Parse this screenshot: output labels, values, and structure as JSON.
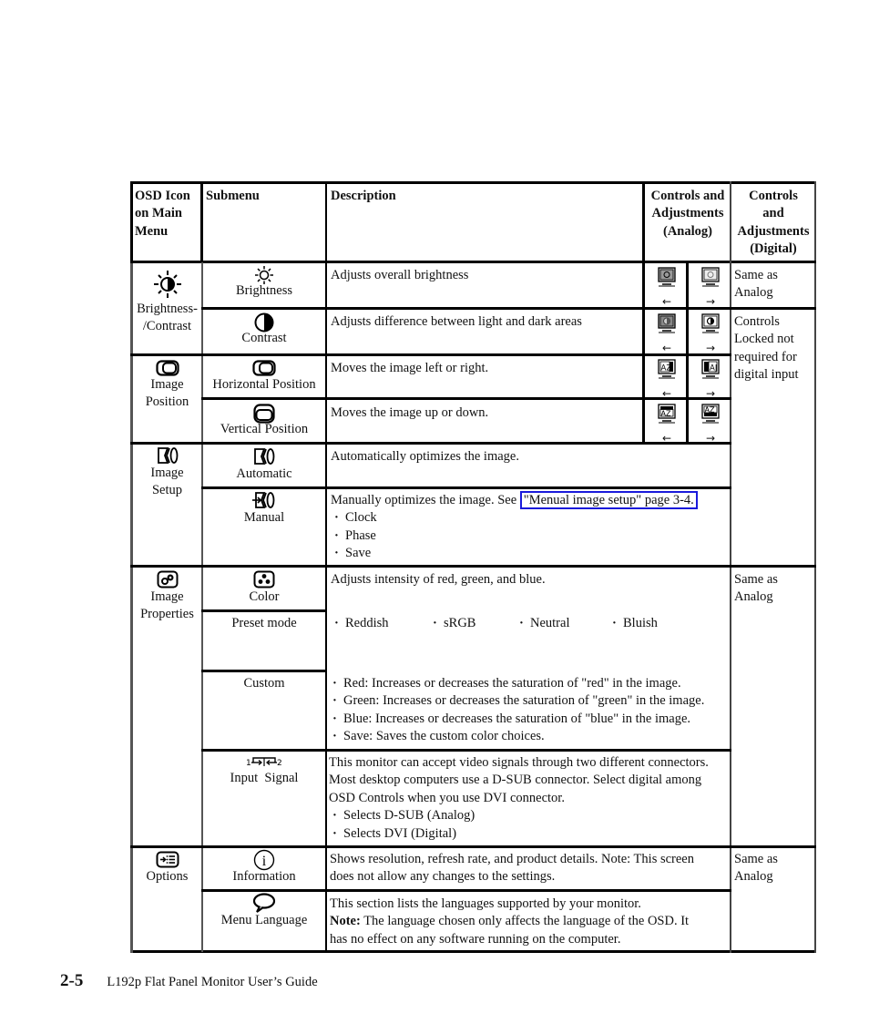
{
  "table": {
    "headers": {
      "osd_icon": [
        "OSD Icon",
        "on Main",
        "Menu"
      ],
      "submenu": "Submenu",
      "description": "Description",
      "analog": [
        "Controls and",
        "Adjustments",
        "(Analog)"
      ],
      "digital": [
        "Controls",
        "and",
        "Adjustments",
        "(Digital)"
      ]
    },
    "groups": {
      "brightness_contrast": {
        "icon": "brightness-contrast-icon",
        "label": [
          "Brightness-",
          "/Contrast"
        ],
        "rows": {
          "brightness": {
            "icon": "sun-icon",
            "submenu": "Brightness",
            "description": "Adjusts overall brightness",
            "controls": {
              "left_icon": "monitor-brightness-down-icon",
              "right_icon": "monitor-brightness-up-icon",
              "left_arrow": "←",
              "right_arrow": "→"
            },
            "digital": [
              "Same as",
              "Analog"
            ]
          },
          "contrast": {
            "icon": "half-circle-icon",
            "submenu": "Contrast",
            "description": "Adjusts difference between light and dark areas",
            "controls": {
              "left_icon": "monitor-contrast-down-icon",
              "right_icon": "monitor-contrast-up-icon",
              "left_arrow": "←",
              "right_arrow": "→"
            },
            "digital": [
              "Controls",
              "Locked not",
              "required for",
              "digital input"
            ]
          }
        }
      },
      "image_position": {
        "icon": "image-position-icon",
        "label": [
          "Image",
          "Position"
        ],
        "rows": {
          "horizontal": {
            "icon": "horizontal-position-icon",
            "submenu": "Horizontal Position",
            "description": "Moves the image left or right.",
            "controls": {
              "left_icon": "monitor-az-left-icon",
              "right_icon": "monitor-az-right-icon",
              "left_arrow": "←",
              "right_arrow": "→"
            }
          },
          "vertical": {
            "icon": "vertical-position-icon",
            "submenu": "Vertical Position",
            "description": "Moves the image up or down.",
            "controls": {
              "left_icon": "monitor-az-down-icon",
              "right_icon": "monitor-az-up-icon",
              "left_arrow": "←",
              "right_arrow": "→"
            }
          }
        }
      },
      "image_setup": {
        "icon": "image-setup-icon",
        "label": [
          "Image",
          "Setup"
        ],
        "rows": {
          "automatic": {
            "icon": "automatic-setup-icon",
            "submenu": "Automatic",
            "description": "Automatically optimizes the image."
          },
          "manual": {
            "icon": "manual-setup-icon",
            "submenu": "Manual",
            "description": "Manually optimizes the image. See ",
            "link": "\"Menual image setup\" page 3-4.",
            "bullets": [
              "Clock",
              "Phase",
              "Save"
            ]
          }
        }
      },
      "image_properties": {
        "icon": "image-properties-icon",
        "label": [
          "Image",
          "Properties"
        ],
        "digital": [
          "Same as",
          "Analog"
        ],
        "rows": {
          "color": {
            "icon": "color-icon",
            "submenu": "Color",
            "description": "Adjusts intensity of red, green, and blue."
          },
          "preset": {
            "submenu": "Preset mode",
            "options": [
              "Reddish",
              "sRGB",
              "Neutral",
              "Bluish"
            ]
          },
          "custom": {
            "submenu": "Custom",
            "bullets": [
              "Red: Increases or decreases the saturation of \"red\" in the image.",
              "Green: Increases or decreases the saturation of \"green\" in the image.",
              "Blue: Increases or decreases the saturation of \"blue\"  in the image.",
              "Save: Saves the custom color choices."
            ]
          },
          "input_signal": {
            "icon": "input-signal-icon",
            "icon_labels": [
              "1",
              "2"
            ],
            "submenu": "Input  Signal",
            "description_lines": [
              "This monitor can accept video signals through two different connectors.",
              "Most desktop computers use a D-SUB connector. Select digital among",
              "OSD Controls when you use DVI connector."
            ],
            "bullets": [
              "Selects D-SUB (Analog)",
              "Selects DVI (Digital)"
            ]
          }
        }
      },
      "options": {
        "icon": "options-icon",
        "label": [
          "Options"
        ],
        "digital": [
          "Same as",
          "Analog"
        ],
        "rows": {
          "information": {
            "icon": "info-icon",
            "submenu": "Information",
            "description_lines": [
              "Shows resolution, refresh rate, and product details. Note: This screen",
              "does not allow any changes to the settings."
            ]
          },
          "menu_language": {
            "icon": "speech-bubble-icon",
            "submenu": "Menu Language",
            "description_lines": [
              "This section lists the languages supported by your monitor."
            ],
            "note_label": "Note:",
            "note_lines": [
              " The language chosen only affects the language of the OSD. It",
              "has no effect on any software running on the computer."
            ]
          }
        }
      }
    }
  },
  "footer": {
    "page_number": "2-5",
    "title": "L192p Flat Panel Monitor User’s Guide"
  },
  "colors": {
    "link_border": "#1a1adb"
  }
}
